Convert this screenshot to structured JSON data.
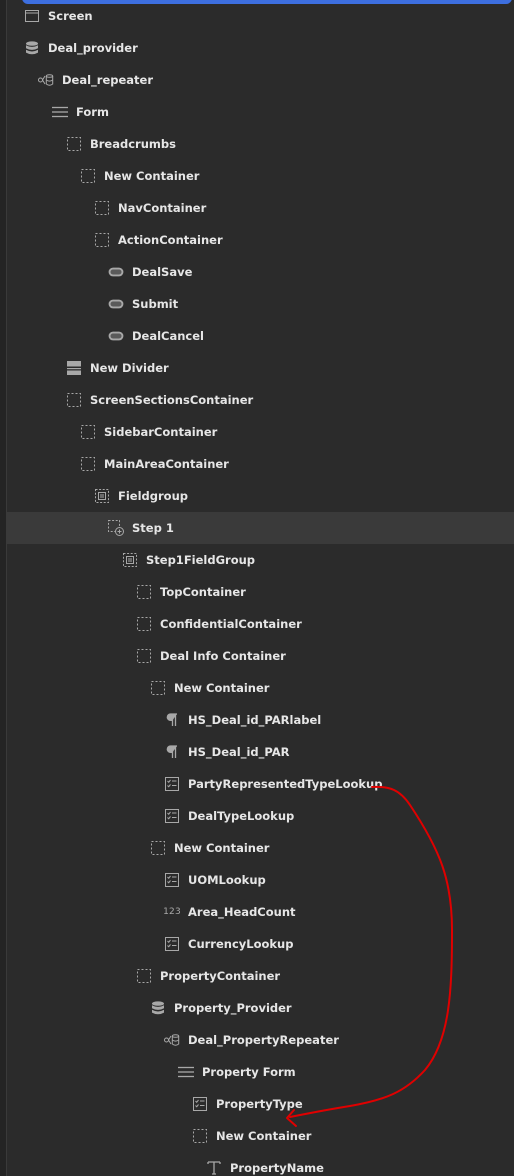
{
  "tree": {
    "items": [
      {
        "label": "Screen",
        "depth": 0,
        "icon": "screen-icon"
      },
      {
        "label": "Deal_provider",
        "depth": 0,
        "icon": "database-icon"
      },
      {
        "label": "Deal_repeater",
        "depth": 1,
        "icon": "repeater-icon"
      },
      {
        "label": "Form",
        "depth": 2,
        "icon": "form-icon"
      },
      {
        "label": "Breadcrumbs",
        "depth": 3,
        "icon": "container-icon"
      },
      {
        "label": "New Container",
        "depth": 4,
        "icon": "container-icon"
      },
      {
        "label": "NavContainer",
        "depth": 5,
        "icon": "container-icon"
      },
      {
        "label": "ActionContainer",
        "depth": 5,
        "icon": "container-icon"
      },
      {
        "label": "DealSave",
        "depth": 6,
        "icon": "button-icon"
      },
      {
        "label": "Submit",
        "depth": 6,
        "icon": "button-icon"
      },
      {
        "label": "DealCancel",
        "depth": 6,
        "icon": "button-icon"
      },
      {
        "label": "New Divider",
        "depth": 3,
        "icon": "divider-icon"
      },
      {
        "label": "ScreenSectionsContainer",
        "depth": 3,
        "icon": "container-icon"
      },
      {
        "label": "SidebarContainer",
        "depth": 4,
        "icon": "container-icon"
      },
      {
        "label": "MainAreaContainer",
        "depth": 4,
        "icon": "container-icon"
      },
      {
        "label": "Fieldgroup",
        "depth": 5,
        "icon": "fieldgroup-icon"
      },
      {
        "label": "Step 1",
        "depth": 6,
        "icon": "step-icon",
        "selected": true
      },
      {
        "label": "Step1FieldGroup",
        "depth": 7,
        "icon": "fieldgroup-icon"
      },
      {
        "label": "TopContainer",
        "depth": 8,
        "icon": "container-icon"
      },
      {
        "label": "ConfidentialContainer",
        "depth": 8,
        "icon": "container-icon"
      },
      {
        "label": "Deal Info Container",
        "depth": 8,
        "icon": "container-icon"
      },
      {
        "label": "New Container",
        "depth": 9,
        "icon": "container-icon"
      },
      {
        "label": "HS_Deal_id_PARlabel",
        "depth": 10,
        "icon": "paragraph-icon"
      },
      {
        "label": "HS_Deal_id_PAR",
        "depth": 10,
        "icon": "paragraph-icon"
      },
      {
        "label": "PartyRepresentedTypeLookup",
        "depth": 10,
        "icon": "lookup-icon"
      },
      {
        "label": "DealTypeLookup",
        "depth": 10,
        "icon": "lookup-icon"
      },
      {
        "label": "New Container",
        "depth": 9,
        "icon": "container-icon"
      },
      {
        "label": "UOMLookup",
        "depth": 10,
        "icon": "lookup-icon"
      },
      {
        "label": "Area_HeadCount",
        "depth": 10,
        "icon": "number-icon"
      },
      {
        "label": "CurrencyLookup",
        "depth": 10,
        "icon": "lookup-icon"
      },
      {
        "label": "PropertyContainer",
        "depth": 8,
        "icon": "container-icon"
      },
      {
        "label": "Property_Provider",
        "depth": 9,
        "icon": "database-icon"
      },
      {
        "label": "Deal_PropertyRepeater",
        "depth": 10,
        "icon": "repeater-icon"
      },
      {
        "label": "Property Form",
        "depth": 11,
        "icon": "form-icon"
      },
      {
        "label": "PropertyType",
        "depth": 12,
        "icon": "lookup-icon"
      },
      {
        "label": "New Container",
        "depth": 12,
        "icon": "container-icon"
      },
      {
        "label": "PropertyName",
        "depth": 13,
        "icon": "text-icon"
      }
    ]
  },
  "colors": {
    "background": "#2b2b2b",
    "selected_row": "#3a3a3a",
    "text": "#e6e6e6",
    "icon": "#a8a8a8",
    "accent": "#3d6fe0",
    "annotation": "#e00000"
  }
}
